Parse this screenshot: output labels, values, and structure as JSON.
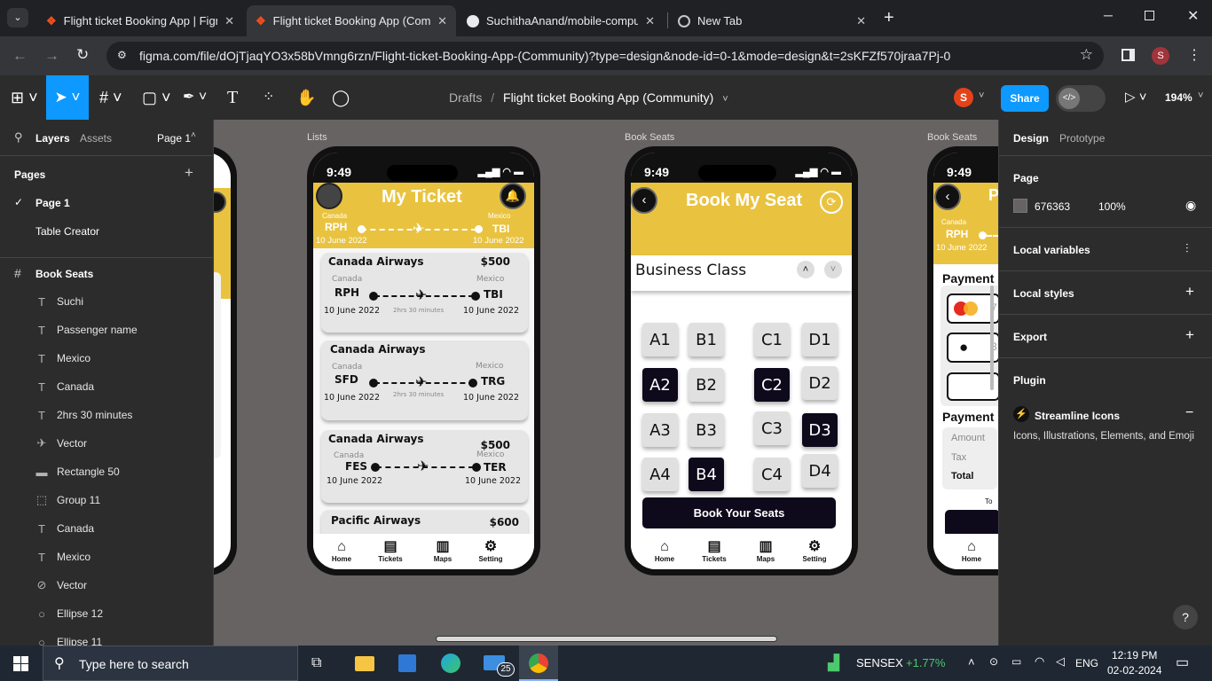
{
  "browser": {
    "tabs": [
      {
        "title": "Flight ticket Booking App | Figma",
        "close": "✕"
      },
      {
        "title": "Flight ticket Booking App (Community)",
        "close": "✕"
      },
      {
        "title": "SuchithaAnand/mobile-computer-use",
        "close": "✕"
      },
      {
        "title": "New Tab",
        "close": "✕"
      }
    ],
    "new_tab": "+",
    "url": "figma.com/file/dOjTjaqYO3x58bVmng6rzn/Flight-ticket-Booking-App-(Community)?type=design&node-id=0-1&mode=design&t=2sKFZf570jraa7Pj-0",
    "profile_initial": "S"
  },
  "figma": {
    "breadcrumb_root": "Drafts",
    "breadcrumb_sep": "/",
    "file_name": "Flight ticket Booking App (Community)",
    "avatar_initial": "S",
    "share_label": "Share",
    "zoom": "194%",
    "left": {
      "tab_layers": "Layers",
      "tab_assets": "Assets",
      "page_selector": "Page 1",
      "pages_title": "Pages",
      "pages": [
        "Page 1",
        "Table Creator"
      ],
      "frame_name": "Book Seats",
      "layers": [
        {
          "icon": "T",
          "name": "Suchi"
        },
        {
          "icon": "T",
          "name": "Passenger name"
        },
        {
          "icon": "T",
          "name": "Mexico"
        },
        {
          "icon": "T",
          "name": "Canada"
        },
        {
          "icon": "T",
          "name": "2hrs 30 minutes"
        },
        {
          "icon": "✈",
          "name": "Vector"
        },
        {
          "icon": "▬",
          "name": "Rectangle 50"
        },
        {
          "icon": "⬚",
          "name": "Group 11"
        },
        {
          "icon": "T",
          "name": "Canada"
        },
        {
          "icon": "T",
          "name": "Mexico"
        },
        {
          "icon": "⊘",
          "name": "Vector"
        },
        {
          "icon": "○",
          "name": "Ellipse 12"
        },
        {
          "icon": "○",
          "name": "Ellipse 11"
        }
      ]
    },
    "right": {
      "tab_design": "Design",
      "tab_prototype": "Prototype",
      "page_title": "Page",
      "page_color": "676363",
      "page_opacity": "100%",
      "local_variables": "Local variables",
      "local_styles": "Local styles",
      "export": "Export",
      "plugin": "Plugin",
      "plugin_name": "Streamline Icons",
      "plugin_desc": "Icons, Illustrations, Elements, and Emoji",
      "help": "?"
    },
    "frame_labels": [
      "Lists",
      "Book Seats",
      "Book Seats"
    ]
  },
  "ticket_screen": {
    "time": "9:49",
    "title": "My Ticket",
    "header_from_country": "Canada",
    "header_from_code": "RPH",
    "header_from_date": "10 June 2022",
    "header_to_country": "Mexico",
    "header_to_code": "TBI",
    "header_to_date": "10 June 2022",
    "cards": [
      {
        "airline": "Canada Airways",
        "price": "$500",
        "from_country": "Canada",
        "from": "RPH",
        "to_country": "Mexico",
        "to": "TBI",
        "date_from": "10 June 2022",
        "date_to": "10 June 2022",
        "duration": "2hrs 30 minutes"
      },
      {
        "airline": "Canada Airways",
        "price": "",
        "from_country": "Canada",
        "from": "SFD",
        "to_country": "Mexico",
        "to": "TRG",
        "date_from": "10 June 2022",
        "date_to": "10 June 2022",
        "duration": "2hrs 30 minutes"
      },
      {
        "airline": "Canada Airways",
        "price": "$500",
        "from_country": "Canada",
        "from": "FES",
        "to_country": "Mexico",
        "to": "TER",
        "date_from": "10 June 2022",
        "date_to": "10 June 2022",
        "duration": ""
      },
      {
        "airline": "Pacific Airways",
        "price": "$600"
      }
    ],
    "nav": [
      "Home",
      "Tickets",
      "Maps",
      "Setting"
    ]
  },
  "seat_screen": {
    "time": "9:49",
    "title": "Book My Seat",
    "class_label": "Business Class",
    "seats": [
      {
        "label": "A1",
        "selected": false
      },
      {
        "label": "B1",
        "selected": false
      },
      {
        "label": "C1",
        "selected": false
      },
      {
        "label": "D1",
        "selected": false
      },
      {
        "label": "A2",
        "selected": true
      },
      {
        "label": "B2",
        "selected": false
      },
      {
        "label": "C2",
        "selected": true
      },
      {
        "label": "D2",
        "selected": false
      },
      {
        "label": "A3",
        "selected": false
      },
      {
        "label": "B3",
        "selected": false
      },
      {
        "label": "C3",
        "selected": false
      },
      {
        "label": "D3",
        "selected": true
      },
      {
        "label": "A4",
        "selected": false
      },
      {
        "label": "B4",
        "selected": true
      },
      {
        "label": "C4",
        "selected": false
      },
      {
        "label": "D4",
        "selected": false
      }
    ],
    "cta": "Book Your Seats",
    "nav": [
      "Home",
      "Tickets",
      "Maps",
      "Setting"
    ]
  },
  "payment_screen": {
    "time": "9:49",
    "title_partial": "Pa",
    "from_country": "Canada",
    "from_code": "RPH",
    "date": "10 June 2022",
    "section1": "Payment",
    "section2": "Payment",
    "amount": "Amount",
    "tax": "Tax",
    "total": "Total",
    "total_partial": "To",
    "nav_home": "Home",
    "digit1": "7",
    "digit2": "3"
  },
  "taskbar": {
    "search_placeholder": "Type here to search",
    "mail_badge": "25",
    "ticker_name": "SENSEX",
    "ticker_change": "+1.77%",
    "lang": "ENG",
    "time": "12:19 PM",
    "date": "02-02-2024"
  },
  "colors": {
    "accent_yellow": "#e9c340",
    "figma_blue": "#0d99ff",
    "ticker_green": "#4cc96e"
  }
}
